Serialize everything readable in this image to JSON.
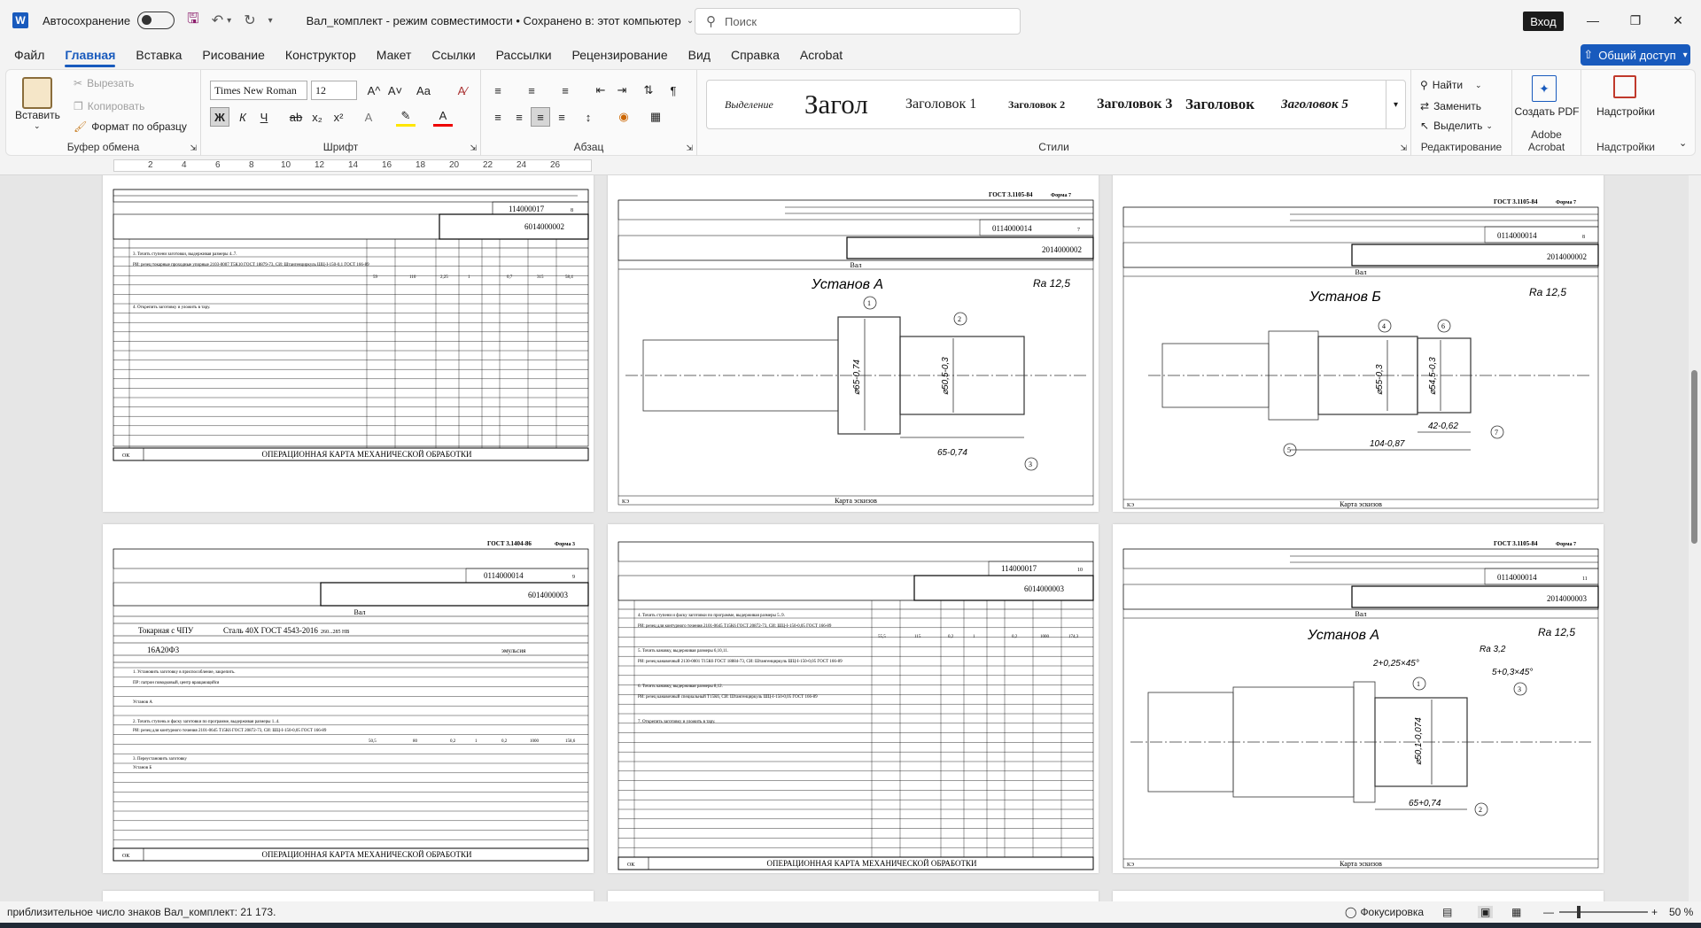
{
  "titlebar": {
    "app_icon": "word-icon",
    "app_letter": "W",
    "autosave_label": "Автосохранение",
    "doc_title": "Вал_комплект  -  режим совместимости • Сохранено в: этот компьютер",
    "search_placeholder": "Поиск",
    "signin_label": "Вход"
  },
  "menu": {
    "tabs": [
      "Файл",
      "Главная",
      "Вставка",
      "Рисование",
      "Конструктор",
      "Макет",
      "Ссылки",
      "Рассылки",
      "Рецензирование",
      "Вид",
      "Справка",
      "Acrobat"
    ],
    "active": "Главная",
    "share_label": "Общий доступ"
  },
  "ribbon": {
    "clipboard": {
      "paste": "Вставить",
      "cut": "Вырезать",
      "copy": "Копировать",
      "format_painter": "Формат по образцу",
      "label": "Буфер обмена"
    },
    "font": {
      "name": "Times New Roman",
      "size": "12",
      "bold": "Ж",
      "italic": "К",
      "underline": "Ч",
      "strike": "ab",
      "sub": "x₂",
      "sup": "x²",
      "label": "Шрифт",
      "grow": "A^",
      "shrink": "A˅",
      "case": "Aa"
    },
    "paragraph": {
      "label": "Абзац"
    },
    "styles": {
      "items": [
        "Выделение",
        "Загол",
        "Заголовок 1",
        "Заголовок 2",
        "Заголовок 3",
        "Заголовок",
        "Заголовок 5"
      ],
      "label": "Стили"
    },
    "editing": {
      "find": "Найти",
      "replace": "Заменить",
      "select": "Выделить",
      "label": "Редактирование"
    },
    "acrobat": {
      "create_pdf": "Создать PDF",
      "label": "Adobe Acrobat"
    },
    "addins": {
      "button": "Надстройки",
      "label": "Надстройки"
    }
  },
  "ruler": {
    "ticks": [
      "2",
      "4",
      "6",
      "8",
      "10",
      "12",
      "14",
      "16",
      "18",
      "20",
      "22",
      "24",
      "26"
    ]
  },
  "pages": {
    "p1": {
      "code1": "114000017",
      "code2": "6014000002",
      "sheet": "8",
      "steps": [
        "3. Точить ступени заготовки, выдерживая размеры 4..7.",
        "РИ: резец токарные проходные упорные 2103-0007 Т5К10 ГОСТ 18879-73, СИ: Штангенциркуль ШЦ-I-150-0,1 ГОСТ 166-89",
        "4. Открепить заготовку и уложить в тару."
      ],
      "values": [
        "59",
        "110",
        "2,25",
        "1",
        "0,7",
        "315",
        "58,4"
      ],
      "footer": "ОПЕРАЦИОННАЯ КАРТА МЕХАНИЧЕСКОЙ ОБРАБОТКИ",
      "ok": "ОК"
    },
    "p2": {
      "gost": "ГОСТ 3.1105-84",
      "form": "Форма 7",
      "code1": "0114000014",
      "code2": "2014000002",
      "sheet": "7",
      "part": "Вал",
      "setup": "Установ А",
      "ra": "Ra 12,5",
      "dim1": "⌀65-0,74",
      "dim2": "⌀50,5-0,3",
      "dim3": "65-0,74",
      "footer": "Карта эскизов",
      "ks": "КЭ"
    },
    "p3": {
      "gost": "ГОСТ 3.1105-84",
      "form": "Форма 7",
      "code1": "0114000014",
      "code2": "2014000002",
      "sheet": "8",
      "part": "Вал",
      "setup": "Установ Б",
      "ra": "Ra 12,5",
      "dim1": "⌀55-0,3",
      "dim2": "⌀54,5-0,3",
      "dim3": "42-0,62",
      "dim4": "104-0,87",
      "footer": "Карта эскизов",
      "ks": "КЭ"
    },
    "p4": {
      "gost": "ГОСТ 3.1404-86",
      "form": "Форма 3",
      "code1": "0114000014",
      "code2": "6014000003",
      "sheet": "9",
      "part": "Вал",
      "operation": "Токарная с ЧПУ",
      "material": "Сталь 40Х ГОСТ 4543-2016",
      "hardness": "260...285 НВ",
      "machine": "16А20Ф3",
      "coolant": "эмульсия",
      "steps": [
        "1. Установить заготовку в приспособление, закрепить.",
        "ПР: патрон поводковый, центр вращающийся",
        "Установ А",
        "2. Точить ступень и фаску заготовки по программе, выдерживая размеры 1..4.",
        "РИ: резец для контурного точения 2101-0645 Т15К6 ГОСТ 20872-73, СИ: ШЦ-I-150-0,05 ГОСТ 166-89",
        "3. Переустановить заготовку",
        "Установ Б"
      ],
      "values": [
        "50,5",
        "80",
        "0,2",
        "1",
        "0,2",
        "1000",
        "158,6"
      ],
      "footer": "ОПЕРАЦИОННАЯ КАРТА МЕХАНИЧЕСКОЙ ОБРАБОТКИ",
      "ok": "ОК"
    },
    "p5": {
      "code1": "114000017",
      "code2": "6014000003",
      "sheet": "10",
      "steps": [
        "4. Точить ступени и фаску заготовки по программе, выдерживая размеры 5..9.",
        "РИ: резец для контурного точения 2101-0645 Т15К6 ГОСТ 20872-73, СИ: ШЦ-I-150-0,05 ГОСТ 166-89",
        "5. Точить канавку, выдерживая размеры 6,10,11.",
        "РИ: резец канавочный 2130-0001 Т15К6 ГОСТ 18884-73, СИ: Штангенциркуль ШЦ-I-150-0,05 ГОСТ 166-89",
        "6. Точить канавку, выдерживая размеры 8,12.",
        "РИ: резец канавочный специальный Т15К6, СИ: Штангенциркуль ШЦ-I-150-0,05 ГОСТ 166-89",
        "7. Открепить заготовку и уложить в тару."
      ],
      "values": [
        "55,5",
        "115",
        "0,2",
        "1",
        "0,2",
        "1000",
        "174,3"
      ],
      "footer": "ОПЕРАЦИОННАЯ КАРТА МЕХАНИЧЕСКОЙ ОБРАБОТКИ",
      "ok": "ОК"
    },
    "p6": {
      "gost": "ГОСТ 3.1105-84",
      "form": "Форма 7",
      "code1": "0114000014",
      "code2": "2014000003",
      "sheet": "11",
      "part": "Вал",
      "setup": "Установ А",
      "ra": "Ra 12,5",
      "ra2": "Ra 3,2",
      "chamfer1": "2+0,25×45°",
      "chamfer2": "5+0,3×45°",
      "dim1": "⌀50,1-0,074",
      "dim2": "65+0,74",
      "footer": "Карта эскизов",
      "ks": "КЭ"
    }
  },
  "status": {
    "words": "приблизительное число знаков Вал_комплект: 21 173.",
    "focus": "Фокусировка",
    "zoom": "50 %"
  },
  "colors": {
    "accent": "#185abd",
    "text": "#1b1b1b",
    "canvas": "#e6e6e6"
  }
}
